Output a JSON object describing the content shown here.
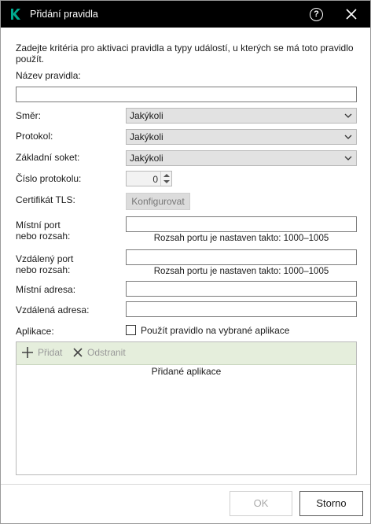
{
  "window": {
    "title": "Přidání pravidla",
    "logo_icon": "kaspersky-k-logo",
    "accent": "#00a88e"
  },
  "intro": "Zadejte kritéria pro aktivaci pravidla a typy událostí, u kterých se má toto pravidlo použít.",
  "rule_name": {
    "label": "Název pravidla:",
    "value": ""
  },
  "direction": {
    "label": "Směr:",
    "value": "Jakýkoli"
  },
  "protocol": {
    "label": "Protokol:",
    "value": "Jakýkoli"
  },
  "socket": {
    "label": "Základní soket:",
    "value": "Jakýkoli"
  },
  "protocol_number": {
    "label": "Číslo protokolu:",
    "value": "0"
  },
  "tls": {
    "label": "Certifikát TLS:",
    "button": "Konfigurovat"
  },
  "local_port": {
    "label_line1": "Místní port",
    "label_line2": "nebo rozsah:",
    "value": "",
    "hint": "Rozsah portu je nastaven takto: 1000–1005"
  },
  "remote_port": {
    "label_line1": "Vzdálený port",
    "label_line2": "nebo rozsah:",
    "value": "",
    "hint": "Rozsah portu je nastaven takto: 1000–1005"
  },
  "local_address": {
    "label": "Místní adresa:",
    "value": ""
  },
  "remote_address": {
    "label": "Vzdálená adresa:",
    "value": ""
  },
  "applications": {
    "label": "Aplikace:",
    "checkbox_label": "Použít pravidlo na vybrané aplikace",
    "checked": false,
    "add": "Přidat",
    "remove": "Odstranit",
    "list_header": "Přidané aplikace",
    "items": []
  },
  "footer": {
    "ok": "OK",
    "cancel": "Storno"
  }
}
